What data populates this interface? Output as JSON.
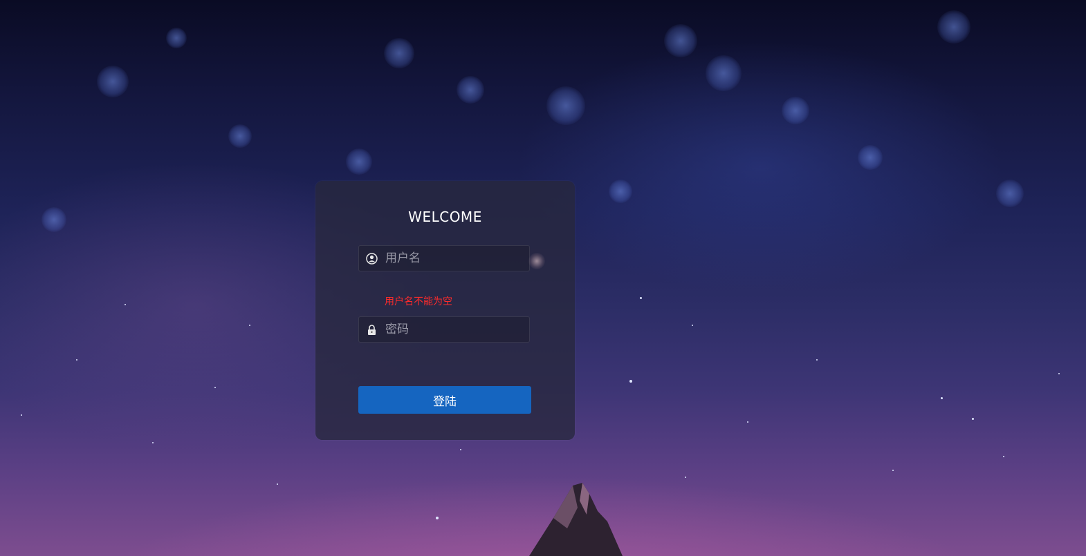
{
  "login": {
    "title": "WELCOME",
    "username": {
      "value": "",
      "placeholder": "用户名",
      "icon": "user-icon",
      "error": "用户名不能为空"
    },
    "password": {
      "value": "",
      "placeholder": "密码",
      "icon": "lock-icon"
    },
    "submit_label": "登陆"
  },
  "colors": {
    "error": "#ff2b2b",
    "button": "#1565c0",
    "card": "#28283e"
  }
}
